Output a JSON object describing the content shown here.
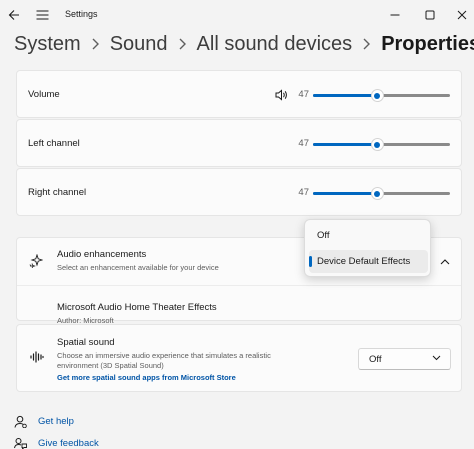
{
  "window": {
    "title": "Settings"
  },
  "breadcrumb": [
    "System",
    "Sound",
    "All sound devices",
    "Properties"
  ],
  "volume": {
    "label": "Volume",
    "value": "47",
    "level": 0.47
  },
  "left_channel": {
    "label": "Left channel",
    "value": "47",
    "level": 0.47
  },
  "right_channel": {
    "label": "Right channel",
    "value": "47",
    "level": 0.47
  },
  "audio_enhancements": {
    "title": "Audio enhancements",
    "subtitle": "Select an enhancement available for your device",
    "options": [
      "Off",
      "Device Default Effects"
    ],
    "selected": "Device Default Effects",
    "effect": {
      "title": "Microsoft Audio Home Theater Effects",
      "author": "Author: Microsoft"
    }
  },
  "spatial_sound": {
    "title": "Spatial sound",
    "description": "Choose an immersive audio experience that simulates a realistic environment (3D Spatial Sound)",
    "link": "Get more spatial sound apps from Microsoft Store",
    "value": "Off"
  },
  "help": {
    "get_help": "Get help",
    "give_feedback": "Give feedback"
  },
  "colors": {
    "accent": "#0067c0",
    "link": "#0054a6",
    "background": "#f3f3f3",
    "card": "#fbfbfb"
  }
}
